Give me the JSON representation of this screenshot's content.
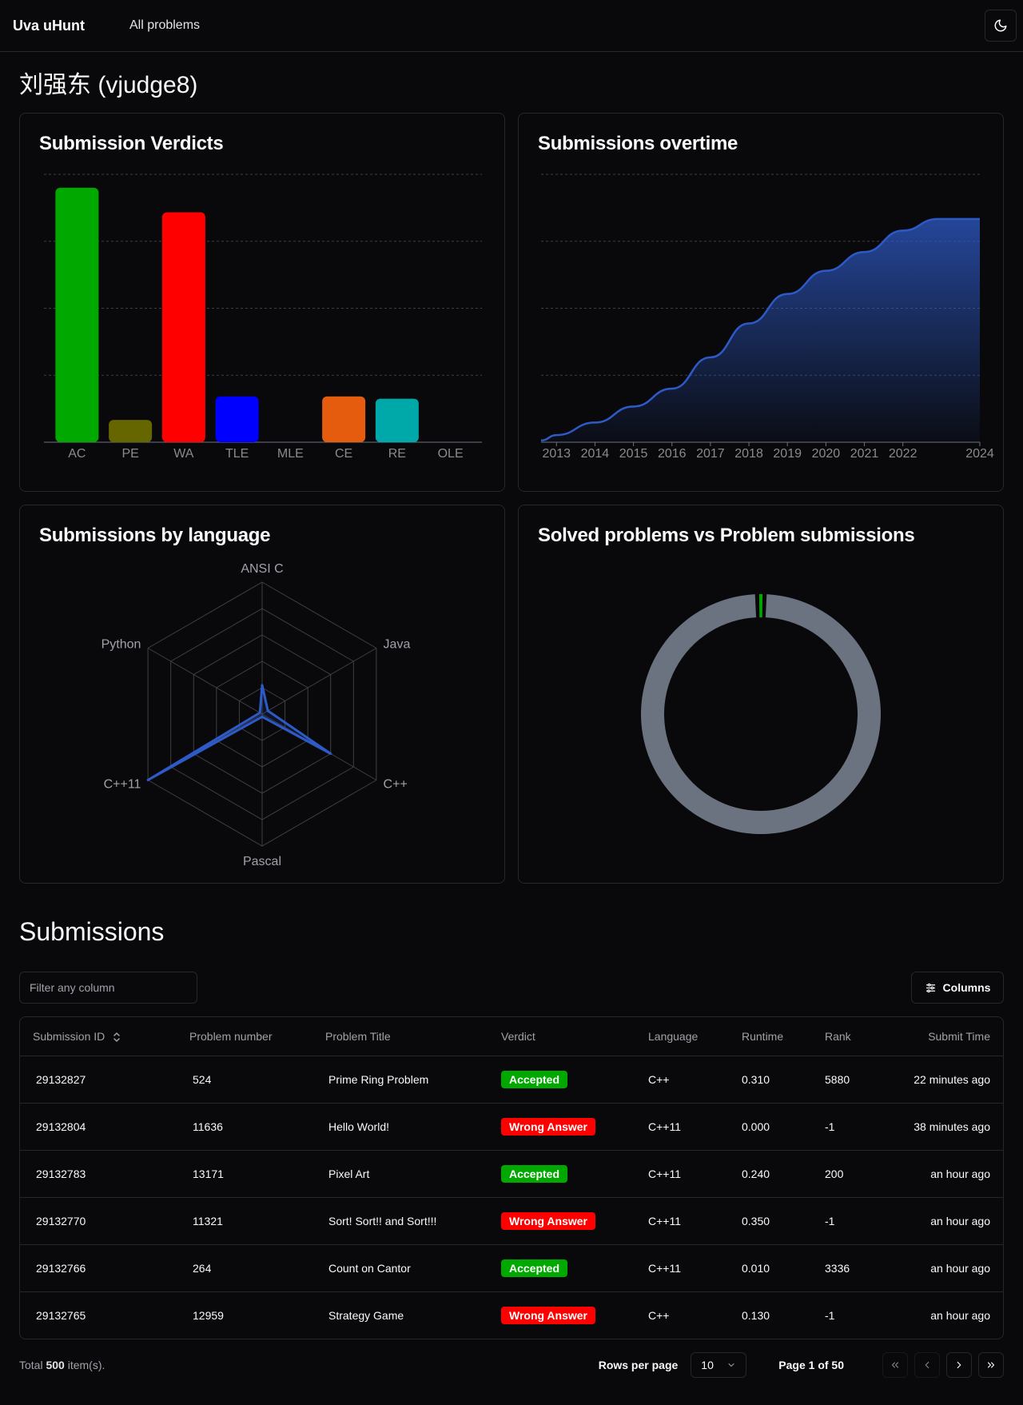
{
  "topbar": {
    "brand": "Uva uHunt",
    "nav_link": "All problems",
    "theme_icon": "moon-icon"
  },
  "user": {
    "title": "刘强东 (vjudge8)"
  },
  "cards": {
    "verdicts_title": "Submission Verdicts",
    "overtime_title": "Submissions overtime",
    "language_title": "Submissions by language",
    "solved_title": "Solved problems vs Problem submissions"
  },
  "chart_data": [
    {
      "type": "bar",
      "title": "Submission Verdicts",
      "categories": [
        "AC",
        "PE",
        "WA",
        "TLE",
        "MLE",
        "CE",
        "RE",
        "OLE"
      ],
      "values": [
        228,
        20,
        206,
        41,
        0,
        41,
        39,
        0
      ],
      "colors": [
        "#00a800",
        "#666600",
        "#ff0000",
        "#0000ff",
        "#6b7280",
        "#e65c0f",
        "#00a9a9",
        "#6b7280"
      ],
      "ylim": [
        0,
        240
      ],
      "grid": true
    },
    {
      "type": "area",
      "title": "Submissions overtime",
      "x": [
        "2012.6",
        "2013",
        "2014",
        "2015",
        "2016",
        "2017",
        "2018",
        "2019",
        "2020",
        "2021",
        "2022",
        "2022.9",
        "2024"
      ],
      "y": [
        2,
        8,
        22,
        40,
        60,
        95,
        133,
        166,
        192,
        213,
        237,
        250,
        250
      ],
      "tick_labels": [
        "2013",
        "2014",
        "2015",
        "2016",
        "2017",
        "2018",
        "2019",
        "2020",
        "2021",
        "2022",
        "2024"
      ],
      "ylim": [
        0,
        300
      ],
      "color": "#2e5ac8",
      "grid": true
    },
    {
      "type": "radar",
      "title": "Submissions by language",
      "axes": [
        "ANSI C",
        "Java",
        "C++",
        "Pascal",
        "C++11",
        "Python"
      ],
      "values": [
        22,
        5,
        60,
        0,
        100,
        0
      ],
      "rmax": 100,
      "color": "#2e5ac8"
    },
    {
      "type": "pie",
      "title": "Solved problems vs Problem submissions",
      "values": [
        1,
        99
      ],
      "colors": [
        "#00a800",
        "#6b7280"
      ]
    }
  ],
  "submissions": {
    "title": "Submissions",
    "filter_placeholder": "Filter any column",
    "columns_button": "Columns",
    "headers": [
      "Submission ID",
      "Problem number",
      "Problem Title",
      "Verdict",
      "Language",
      "Runtime",
      "Rank",
      "Submit Time"
    ],
    "rows": [
      {
        "id": "29132827",
        "num": "524",
        "title": "Prime Ring Problem",
        "verdict": "Accepted",
        "lang": "C++",
        "runtime": "0.310",
        "rank": "5880",
        "time": "22 minutes ago"
      },
      {
        "id": "29132804",
        "num": "11636",
        "title": "Hello World!",
        "verdict": "Wrong Answer",
        "lang": "C++11",
        "runtime": "0.000",
        "rank": "-1",
        "time": "38 minutes ago"
      },
      {
        "id": "29132783",
        "num": "13171",
        "title": "Pixel Art",
        "verdict": "Accepted",
        "lang": "C++11",
        "runtime": "0.240",
        "rank": "200",
        "time": "an hour ago"
      },
      {
        "id": "29132770",
        "num": "11321",
        "title": "Sort! Sort!! and Sort!!!",
        "verdict": "Wrong Answer",
        "lang": "C++11",
        "runtime": "0.350",
        "rank": "-1",
        "time": "an hour ago"
      },
      {
        "id": "29132766",
        "num": "264",
        "title": "Count on Cantor",
        "verdict": "Accepted",
        "lang": "C++11",
        "runtime": "0.010",
        "rank": "3336",
        "time": "an hour ago"
      },
      {
        "id": "29132765",
        "num": "12959",
        "title": "Strategy Game",
        "verdict": "Wrong Answer",
        "lang": "C++",
        "runtime": "0.130",
        "rank": "-1",
        "time": "an hour ago"
      }
    ],
    "verdict_colors": {
      "Accepted": "#00a800",
      "Wrong Answer": "#ff0000"
    }
  },
  "footer": {
    "total_prefix": "Total ",
    "total_count": "500",
    "total_suffix": " item(s).",
    "rows_per_page_label": "Rows per page",
    "rows_per_page_value": "10",
    "page_label": "Page 1 of 50"
  }
}
